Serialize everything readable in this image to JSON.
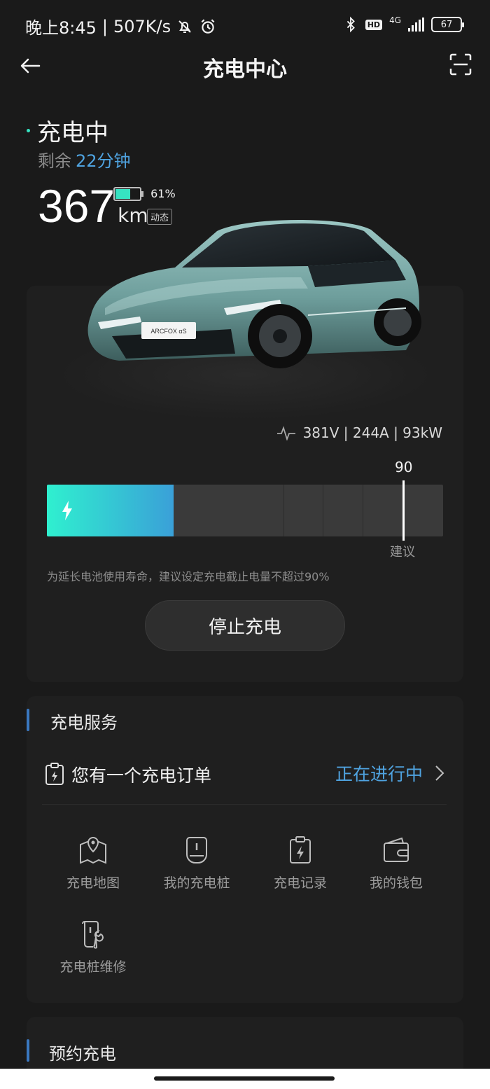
{
  "status_bar": {
    "time": "晚上8:45",
    "net_speed": "507K/s",
    "network": "4G",
    "hd": "HD",
    "battery": "67"
  },
  "header": {
    "title": "充电中心"
  },
  "charging": {
    "state": "充电中",
    "remaining_label": "剩余",
    "remaining_time": "22分钟",
    "range_value": "367",
    "range_unit": "km",
    "battery_percent_text": "61%",
    "battery_level": 0.61,
    "dynamic_label": "动态",
    "car_plate_text": "ARCFOX αS",
    "power_readout": "381V | 244A | 93kW",
    "charge_level": 0.32,
    "limit_value": "90",
    "limit_label": "建议",
    "advice": "为延长电池使用寿命，建议设定充电截止电量不超过90%",
    "stop_button": "停止充电"
  },
  "services": {
    "title": "充电服务",
    "order_text": "您有一个充电订单",
    "order_status": "正在进行中",
    "items": [
      {
        "label": "充电地图",
        "icon": "map-pin-icon"
      },
      {
        "label": "我的充电桩",
        "icon": "charger-icon"
      },
      {
        "label": "充电记录",
        "icon": "charge-record-icon"
      },
      {
        "label": "我的钱包",
        "icon": "wallet-icon"
      },
      {
        "label": "充电桩维修",
        "icon": "repair-icon"
      }
    ]
  },
  "reserve": {
    "title": "预约充电"
  },
  "colors": {
    "accent_teal": "#36e3c2",
    "accent_blue": "#4fa3e0",
    "background": "#1a1a1a",
    "card": "#1f1f1f"
  }
}
